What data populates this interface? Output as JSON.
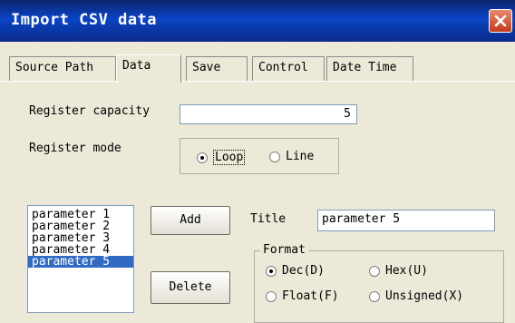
{
  "window": {
    "title": "Import CSV data"
  },
  "tabs": [
    "Source Path",
    "Data",
    "Save",
    "Control",
    "Date Time"
  ],
  "register_capacity": {
    "label": "Register capacity",
    "value": "5"
  },
  "register_mode": {
    "label": "Register mode",
    "options": [
      "Loop",
      "Line"
    ],
    "selected": "Loop"
  },
  "parameters": {
    "items": [
      "parameter 1",
      "parameter 2",
      "parameter 3",
      "parameter 4",
      "parameter 5"
    ],
    "selected": "parameter 5"
  },
  "buttons": {
    "add": "Add",
    "delete": "Delete"
  },
  "title_field": {
    "label": "Title",
    "value": "parameter 5"
  },
  "format": {
    "label": "Format",
    "options": [
      "Dec(D)",
      "Hex(U)",
      "Float(F)",
      "Unsigned(X)"
    ],
    "selected": "Dec(D)"
  }
}
